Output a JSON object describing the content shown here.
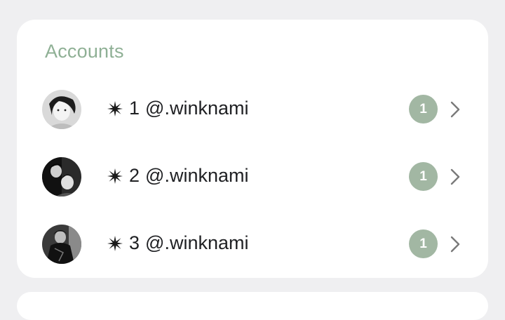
{
  "accounts_section": {
    "title": "Accounts",
    "items": [
      {
        "index": "1",
        "handle": "@.winknami",
        "badge": "1",
        "avatar_icon": "avatar-photo"
      },
      {
        "index": "2",
        "handle": "@.winknami",
        "badge": "1",
        "avatar_icon": "avatar-photo"
      },
      {
        "index": "3",
        "handle": "@.winknami",
        "badge": "1",
        "avatar_icon": "avatar-photo"
      }
    ],
    "star_icon": "asterisk-star-icon",
    "chevron_icon": "chevron-right-icon"
  },
  "colors": {
    "background": "#efeff1",
    "card": "#ffffff",
    "accent_title": "#8fb095",
    "badge": "#a2b7a3",
    "text": "#202124",
    "chevron": "#7a7a7a"
  }
}
